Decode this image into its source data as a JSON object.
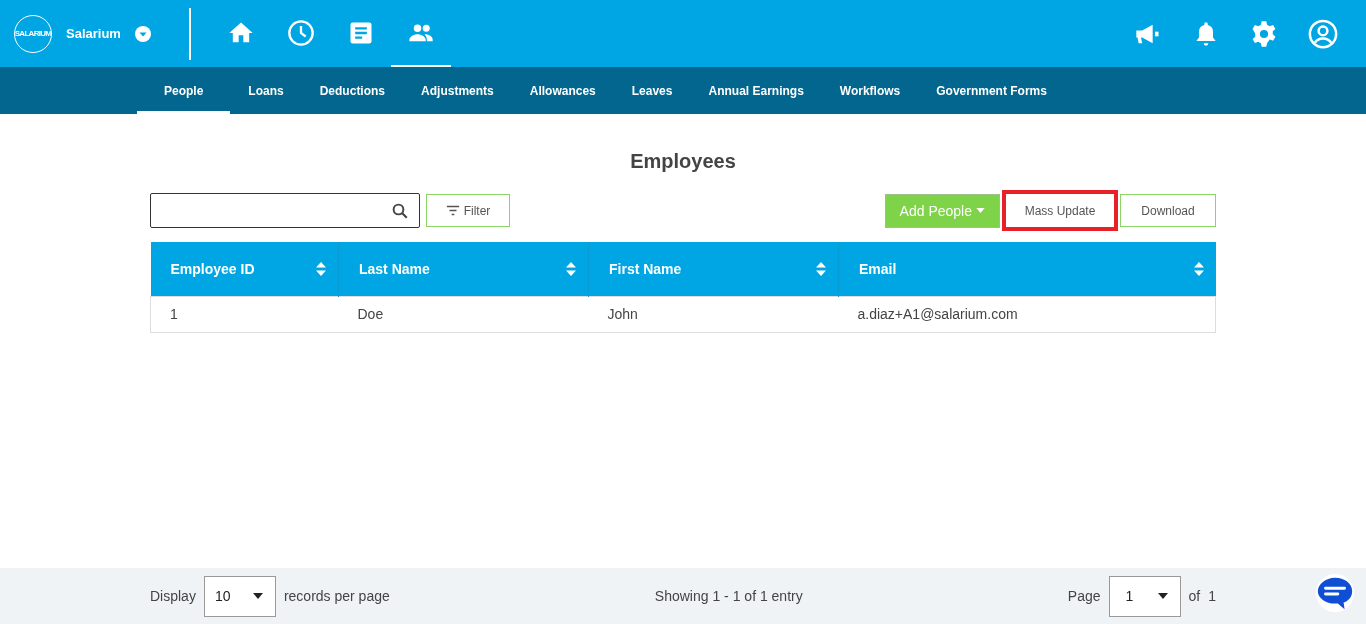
{
  "header": {
    "logo_text": "SALARIUM",
    "company": "Salarium",
    "nav_icons": [
      {
        "kind": "home",
        "selected": false
      },
      {
        "kind": "clock",
        "selected": false
      },
      {
        "kind": "document",
        "selected": false
      },
      {
        "kind": "people",
        "selected": true
      }
    ],
    "action_icons": [
      {
        "kind": "megaphone"
      },
      {
        "kind": "bell"
      },
      {
        "kind": "settings"
      },
      {
        "kind": "user"
      }
    ]
  },
  "tabs": [
    {
      "label": "People",
      "selected": true
    },
    {
      "label": "Loans",
      "selected": false
    },
    {
      "label": "Deductions",
      "selected": false
    },
    {
      "label": "Adjustments",
      "selected": false
    },
    {
      "label": "Allowances",
      "selected": false
    },
    {
      "label": "Leaves",
      "selected": false
    },
    {
      "label": "Annual Earnings",
      "selected": false
    },
    {
      "label": "Workflows",
      "selected": false
    },
    {
      "label": "Government Forms",
      "selected": false
    }
  ],
  "page_title": "Employees",
  "toolbar": {
    "filter": "Filter",
    "add_people": "Add People",
    "buttons": [
      {
        "label": "Mass Update",
        "highlighted": true
      },
      {
        "label": "Download",
        "highlighted": false
      }
    ]
  },
  "table": {
    "columns": [
      "Employee ID",
      "Last Name",
      "First Name",
      "Email"
    ],
    "rows": [
      [
        "1",
        "Doe",
        "John",
        "a.diaz+A1@salarium.com"
      ]
    ]
  },
  "footer": {
    "display_label": "Display",
    "page_size": "10",
    "per_page_label": "records per page",
    "showing": "Showing 1 - 1 of 1 entry",
    "page_label": "Page",
    "page": "1",
    "of_label": "of",
    "total_pages": "1"
  }
}
